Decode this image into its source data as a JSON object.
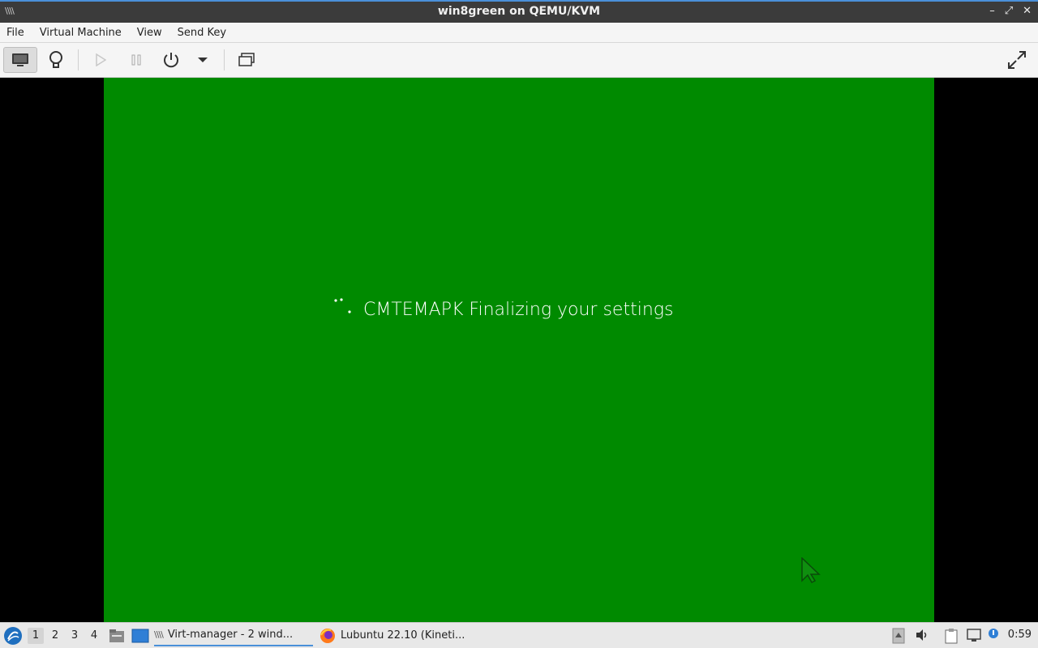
{
  "window": {
    "title": "win8green on QEMU/KVM",
    "app_icon": "virt-manager-icon",
    "controls": {
      "minimize": "–",
      "maximize": "⤢",
      "close": "✕"
    }
  },
  "menu": [
    "File",
    "Virtual Machine",
    "View",
    "Send Key"
  ],
  "toolbar": {
    "buttons": [
      "console-view",
      "details-view",
      "run",
      "pause",
      "shutdown",
      "shutdown-menu",
      "snapshots",
      "fullscreen"
    ]
  },
  "guest": {
    "background": "#008a00",
    "message": "CMTEMAPK Finalizing your settings"
  },
  "taskbar": {
    "workspaces": [
      "1",
      "2",
      "3",
      "4"
    ],
    "active_workspace": "1",
    "tasks": [
      {
        "label": "Virt-manager - 2 wind...",
        "icon": "virt-manager-icon"
      },
      {
        "label": "Lubuntu 22.10 (Kineti...",
        "icon": "firefox-icon"
      }
    ],
    "clock": "0:59"
  },
  "colors": {
    "accent": "#4a90d9",
    "titlebar": "#3b3b3b",
    "guest_green": "#008a00"
  }
}
